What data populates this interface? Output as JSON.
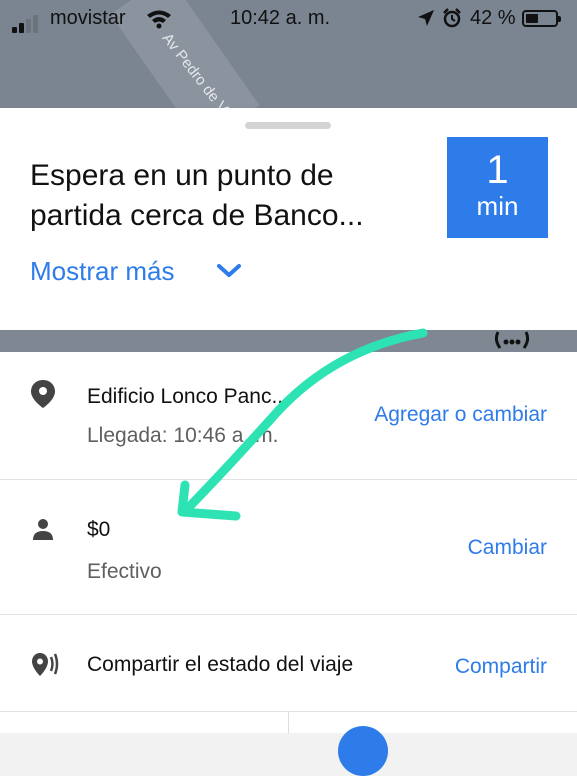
{
  "status_bar": {
    "carrier": "movistar",
    "time": "10:42 a. m.",
    "battery_percent": "42 %",
    "battery_level": 0.42
  },
  "map": {
    "street_label": "Av Pedro de Valdivia"
  },
  "wait_card": {
    "title": "Espera en un punto de partida cerca de Banco...",
    "eta_value": "1",
    "eta_unit": "min",
    "more_link": "Mostrar más"
  },
  "trip_details": {
    "destination": {
      "name": "Edificio Lonco Panc...",
      "arrival": "Llegada: 10:46 a. m.",
      "action": "Agregar o cambiar"
    },
    "payment": {
      "amount": "$0",
      "method": "Efectivo",
      "action": "Cambiar"
    },
    "share": {
      "label": "Compartir el estado del viaje",
      "action": "Compartir"
    }
  },
  "colors": {
    "accent": "#2e7bea",
    "annotation": "#2de3b4"
  },
  "icons": [
    "location-pin-icon",
    "person-icon",
    "share-status-icon",
    "chevron-down-icon"
  ]
}
